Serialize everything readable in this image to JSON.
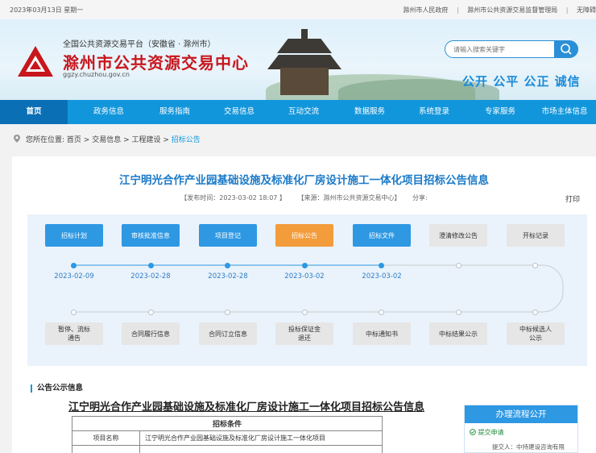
{
  "topbar": {
    "date": "2023年03月13日 星期一",
    "links": [
      "滁州市人民政府",
      "滁州市公共资源交易监督管理局",
      "无障碍"
    ]
  },
  "header": {
    "small_title": "全国公共资源交易平台（安徽省 · 滁州市）",
    "big_title": "滁州市公共资源交易中心",
    "url": "ggzy.chuzhou.gov.cn",
    "search_placeholder": "请输入搜索关键字",
    "slogan": "公开 公平 公正 诚信",
    "brand_color": "#c8161d"
  },
  "nav": {
    "items": [
      "首页",
      "政务信息",
      "服务指南",
      "交易信息",
      "互动交流",
      "数据服务",
      "系统登录",
      "专家服务",
      "市场主体信息"
    ],
    "active": "首页",
    "color": "#1296db"
  },
  "breadcrumb": {
    "prefix": "您所在位置:",
    "path": [
      "首页",
      "交易信息",
      "工程建设",
      "招标公告"
    ]
  },
  "article": {
    "title": "江宁明光合作产业园基础设施及标准化厂房设计施工一体化项目招标公告信息",
    "publish_time": "【发布时间：2023-03-02 18:07 】",
    "source": "【来源：滁州市公共资源交易中心】",
    "share": "分享:",
    "print": "打印"
  },
  "timeline": {
    "top_steps": [
      {
        "label": "招标计划",
        "state": "done",
        "date": "2023-02-09"
      },
      {
        "label": "审核批准信息",
        "state": "done",
        "date": "2023-02-28"
      },
      {
        "label": "项目登记",
        "state": "done",
        "date": "2023-02-28"
      },
      {
        "label": "招标公告",
        "state": "current",
        "date": "2023-03-02"
      },
      {
        "label": "招标文件",
        "state": "done",
        "date": "2023-03-02"
      },
      {
        "label": "澄清修改公告",
        "state": "pending",
        "date": ""
      },
      {
        "label": "开标记录",
        "state": "pending",
        "date": ""
      }
    ],
    "bottom_steps": [
      {
        "label": "暂停、流标\n通告",
        "state": "pending"
      },
      {
        "label": "合同履行信息",
        "state": "pending"
      },
      {
        "label": "合同订立信息",
        "state": "pending"
      },
      {
        "label": "投标保证金\n退还",
        "state": "pending"
      },
      {
        "label": "中标通知书",
        "state": "pending"
      },
      {
        "label": "中标结果公示",
        "state": "pending"
      },
      {
        "label": "中标候选人\n公示",
        "state": "pending"
      }
    ]
  },
  "notice": {
    "heading": "公告公示信息",
    "doc_title": "江宁明光合作产业园基础设施及标准化厂房设计施工一体化项目招标公告信息",
    "table_header": "招标条件",
    "rows": [
      {
        "key": "项目名称",
        "value": "江宁明光合作产业园基础设施及标准化厂房设计施工一体化项目"
      }
    ]
  },
  "process_panel": {
    "title": "办理流程公开",
    "item": "提交申请",
    "sub": "提交人：中持建设咨询有限"
  }
}
